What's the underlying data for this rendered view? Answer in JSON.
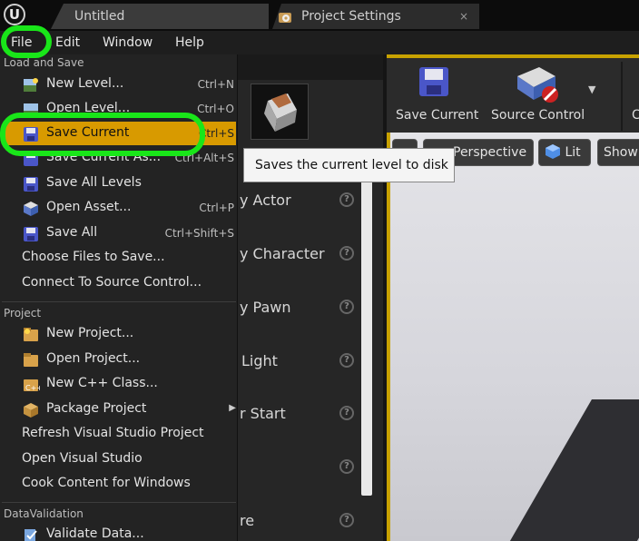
{
  "tabs": [
    {
      "label": "Untitled"
    },
    {
      "label": "Project Settings",
      "close": "×"
    }
  ],
  "logo": {
    "glyph": "U"
  },
  "menubar": {
    "items": [
      "File",
      "Edit",
      "Window",
      "Help"
    ]
  },
  "dropdown": {
    "sections": [
      {
        "heading": "Load and Save"
      },
      {
        "heading": "Project"
      },
      {
        "heading": "DataValidation"
      }
    ],
    "items": [
      {
        "label": "New Level...",
        "shortcut": "Ctrl+N",
        "icon": "new-level-icon"
      },
      {
        "label": "Open Level...",
        "shortcut": "Ctrl+O",
        "icon": "open-level-icon"
      },
      {
        "label": "Save Current",
        "shortcut": "Ctrl+S",
        "icon": "save-icon"
      },
      {
        "label": "Save Current As...",
        "shortcut": "Ctrl+Alt+S",
        "icon": "save-as-icon"
      },
      {
        "label": "Save All Levels",
        "shortcut": "",
        "icon": "save-all-levels-icon"
      },
      {
        "label": "Open Asset...",
        "shortcut": "Ctrl+P",
        "icon": "open-asset-icon"
      },
      {
        "label": "Save All",
        "shortcut": "Ctrl+Shift+S",
        "icon": "save-all-icon"
      },
      {
        "label": "Choose Files to Save...",
        "shortcut": ""
      },
      {
        "label": "Connect To Source Control...",
        "shortcut": ""
      },
      {
        "label": "New Project...",
        "icon": "new-project-icon"
      },
      {
        "label": "Open Project...",
        "icon": "open-project-icon"
      },
      {
        "label": "New C++ Class...",
        "icon": "cpp-class-icon"
      },
      {
        "label": "Package Project",
        "icon": "package-icon"
      },
      {
        "label": "Refresh Visual Studio Project"
      },
      {
        "label": "Open Visual Studio"
      },
      {
        "label": "Cook Content for Windows"
      },
      {
        "label": "Validate Data...",
        "icon": "validate-icon"
      }
    ]
  },
  "tooltip": {
    "text": "Saves the current level to disk"
  },
  "place_panel": {
    "rows": [
      "y Actor",
      "y Character",
      "y Pawn",
      "Light",
      "r Start",
      "re"
    ]
  },
  "toolbar": {
    "save_current": "Save Current",
    "source_control": "Source Control",
    "cut_letter": "C"
  },
  "viewport": {
    "perspective": "Perspective",
    "lit": "Lit",
    "show": "Show"
  },
  "colors": {
    "selection": "#d89a00",
    "annotation": "#19e619",
    "accent_border": "#c8a200"
  }
}
